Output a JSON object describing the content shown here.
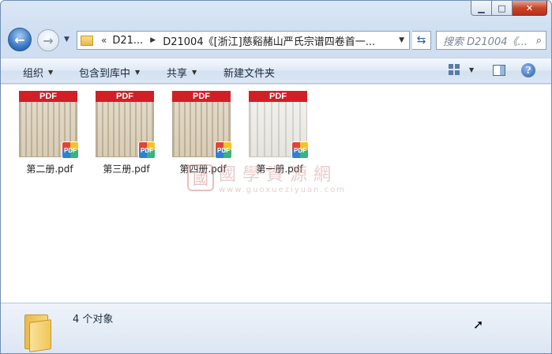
{
  "window": {
    "minimize_icon": "minimize-icon",
    "maximize_icon": "maximize-icon",
    "close_icon": "close-icon"
  },
  "nav": {
    "back_icon": "arrow-left-icon",
    "forward_icon": "arrow-right-icon",
    "breadcrumb_lead": "«",
    "breadcrumbs": [
      "D21...",
      "D21004《[浙江]慈谿赭山严氏宗谱四卷首一..."
    ],
    "search_placeholder": "搜索 D21004《...",
    "refresh_icon": "refresh-icon",
    "search_icon": "search-icon"
  },
  "toolbar": {
    "organize": "组织",
    "include_in_library": "包含到库中",
    "share": "共享",
    "new_folder": "新建文件夹",
    "view_icon": "view-grid-icon",
    "pane_icon": "preview-pane-icon",
    "help_icon": "?"
  },
  "files": [
    {
      "name": "第二册.pdf",
      "banner": "PDF",
      "badge": "PDF"
    },
    {
      "name": "第三册.pdf",
      "banner": "PDF",
      "badge": "PDF"
    },
    {
      "name": "第四册.pdf",
      "banner": "PDF",
      "badge": "PDF"
    },
    {
      "name": "第一册.pdf",
      "banner": "PDF",
      "badge": "PDF"
    }
  ],
  "watermark": {
    "seal": "國",
    "text": "國學資源網",
    "url": "www.guoxueziyuan.com"
  },
  "status": {
    "count_text": "4 个对象"
  },
  "colors": {
    "pdf_red": "#d21f26",
    "window_frame": "#cfdff1",
    "close_red": "#c9452a"
  }
}
